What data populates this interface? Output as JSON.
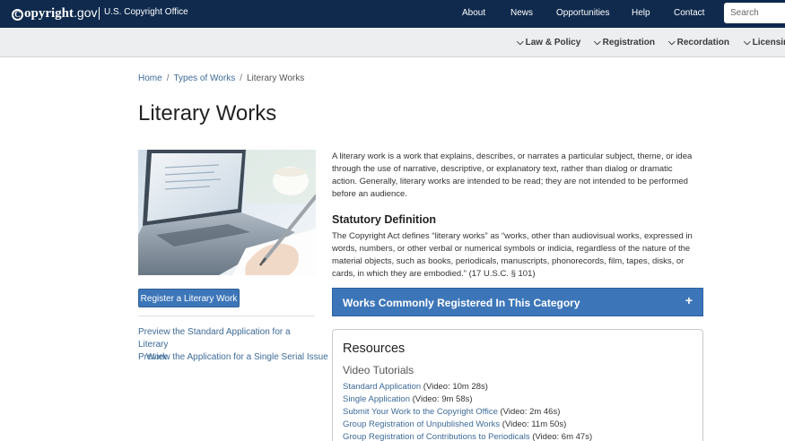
{
  "header": {
    "logo_mark": "C",
    "logo_main": "opyright",
    "logo_gov": ".gov",
    "office": "U.S. Copyright Office",
    "nav": [
      "About",
      "News",
      "Opportunities",
      "Help",
      "Contact"
    ],
    "search_placeholder": "Search"
  },
  "subnav": {
    "items": [
      "Law & Policy",
      "Registration",
      "Recordation",
      "Licensing"
    ]
  },
  "breadcrumb": {
    "items": [
      "Home",
      "Types of Works",
      "Literary Works"
    ],
    "separator": "/"
  },
  "page": {
    "title": "Literary Works",
    "hero_icon": "laptop-writing-photo"
  },
  "left": {
    "register_button": "Register a Literary Work",
    "preview_link_1_line1": "Preview the Standard Application for a Literary",
    "preview_link_1_line2": "Work",
    "preview_link_2": "Preview the Application for a Single Serial Issue"
  },
  "main": {
    "intro": "A literary work is a work that explains, describes, or narrates a particular subject, theme, or idea through the use of narrative, descriptive, or explanatory text, rather than dialog or dramatic action. Generally, literary works are intended to be read; they are not intended to be performed before an audience.",
    "statutory_heading": "Statutory Definition",
    "statutory_body": "The Copyright Act defines “literary works” as “works, other than audiovisual works, expressed in words, numbers, or other verbal or numerical symbols or indicia, regardless of the nature of the material objects, such as books, periodicals, manuscripts, phonorecords, film, tapes, disks, or cards, in which they are embodied.” (17 U.S.C. § 101)",
    "accordion_label": "Works Commonly Registered In This Category",
    "accordion_icon": "+"
  },
  "resources": {
    "title": "Resources",
    "subtitle": "Video Tutorials",
    "items": [
      {
        "link": "Standard Application",
        "meta": " (Video: 10m 28s)"
      },
      {
        "link": "Single Application",
        "meta": " (Video: 9m 58s)"
      },
      {
        "link": "Submit Your Work to the Copyright Office",
        "meta": " (Video: 2m 46s)"
      },
      {
        "link": "Group Registration of Unpublished Works",
        "meta": " (Video: 11m 50s)"
      },
      {
        "link": "Group Registration of Contributions to Periodicals",
        "meta": " (Video: 6m 47s)"
      }
    ]
  },
  "colors": {
    "topbar": "#0f2a4d",
    "subnav": "#eceeef",
    "accent_blue": "#3d76b8",
    "link": "#3d6b99"
  }
}
